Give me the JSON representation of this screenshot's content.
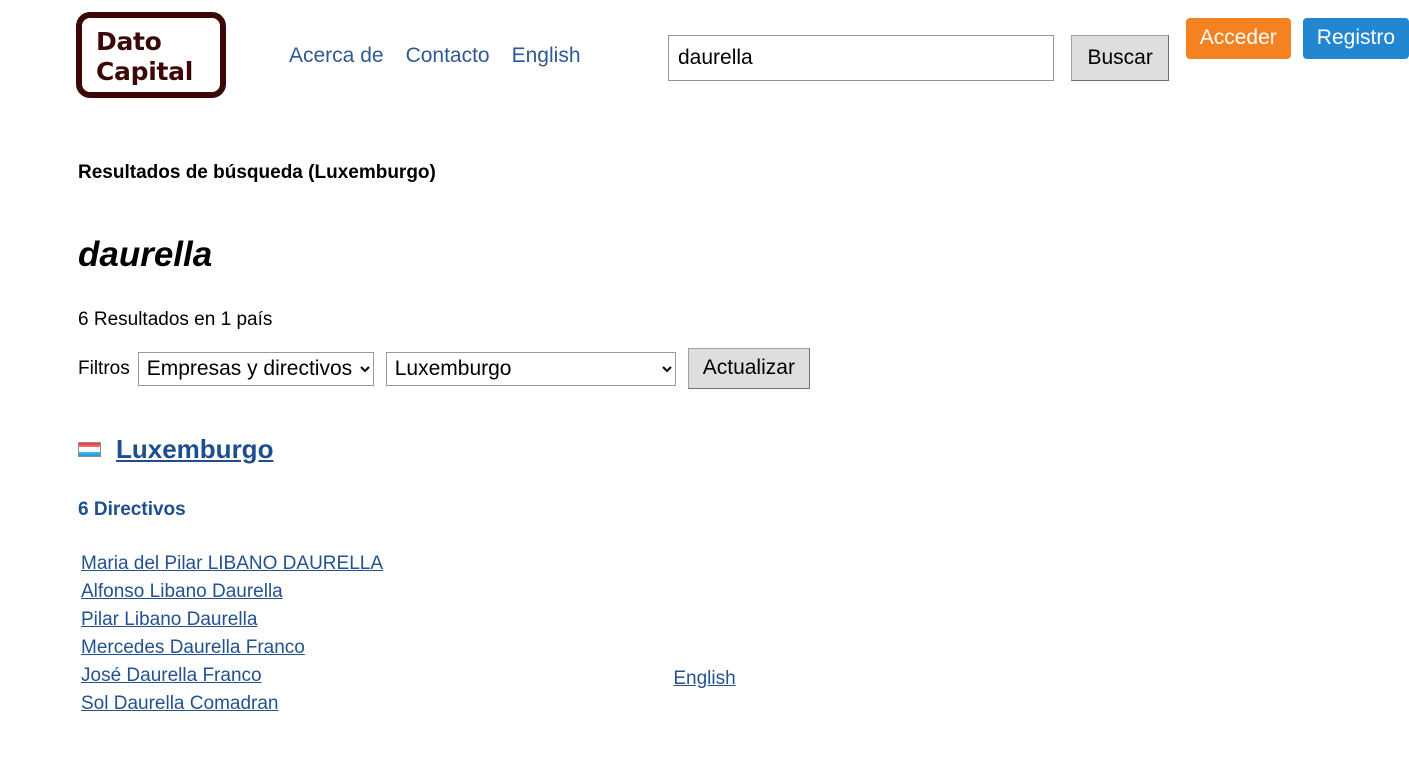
{
  "header": {
    "logo_text": "Dato\nCapital",
    "logo_name": "Dato Capital",
    "nav": [
      {
        "label": "Acerca de"
      },
      {
        "label": "Contacto"
      },
      {
        "label": "English"
      }
    ],
    "search": {
      "value": "daurella",
      "placeholder": "",
      "button_label": "Buscar"
    },
    "auth": {
      "login_label": "Acceder",
      "register_label": "Registro",
      "login_color": "#f58220",
      "register_color": "#2287d0"
    }
  },
  "main": {
    "results_title": "Resultados de búsqueda (Luxemburgo)",
    "query_term": "daurella",
    "count_line": "6 Resultados en 1 país",
    "filters": {
      "label": "Filtros",
      "type_select": {
        "selected": "Empresas y directivos",
        "options": [
          "Empresas y directivos"
        ]
      },
      "country_select": {
        "selected": "Luxemburgo",
        "options": [
          "Luxemburgo"
        ]
      },
      "update_label": "Actualizar"
    },
    "country": {
      "name": "Luxemburgo",
      "flag_name": "luxembourg-flag",
      "section_heading": "6 Directivos",
      "people": [
        {
          "name": "Maria del Pilar LIBANO DAURELLA"
        },
        {
          "name": "Alfonso Libano Daurella"
        },
        {
          "name": "Pilar Libano Daurella"
        },
        {
          "name": "Mercedes Daurella Franco"
        },
        {
          "name": "José Daurella Franco"
        },
        {
          "name": "Sol Daurella Comadran"
        }
      ]
    }
  },
  "footer": {
    "language_link": "English"
  }
}
